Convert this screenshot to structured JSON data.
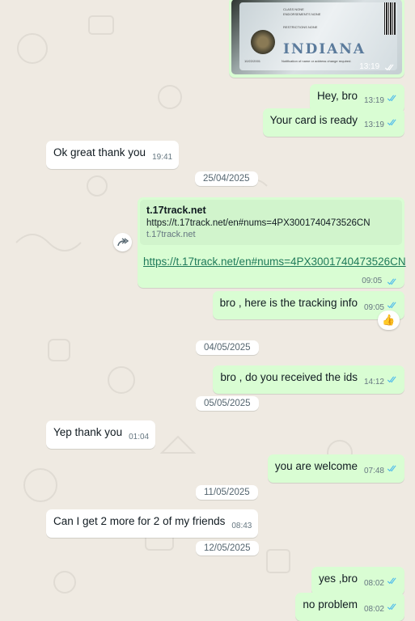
{
  "chat": {
    "id_card": {
      "state": "INDIANA",
      "time": "13:19",
      "fine_print": {
        "class": "CLASS NONE",
        "endorsements": "ENDORSEMENTS NONE",
        "restrictions": "RESTRICTIONS NONE",
        "notice": "Notification of name or address change required.",
        "date": "10/22/2001"
      }
    },
    "messages": [
      {
        "text": "Hey, bro",
        "time": "13:19"
      },
      {
        "text": "Your card is ready",
        "time": "13:19"
      },
      {
        "text": "Ok great thank you",
        "time": "19:41"
      },
      {
        "text": "bro , here is the tracking info",
        "time": "09:05"
      },
      {
        "text": "bro , do you received the ids",
        "time": "14:12"
      },
      {
        "text": "Yep thank you",
        "time": "01:04"
      },
      {
        "text": "you are welcome",
        "time": "07:48"
      },
      {
        "text": "Can I get 2 more for 2 of my friends",
        "time": "08:43"
      },
      {
        "text": "yes ,bro",
        "time": "08:02"
      },
      {
        "text": "no problem",
        "time": "08:02"
      }
    ],
    "dates": [
      "25/04/2025",
      "04/05/2025",
      "05/05/2025",
      "11/05/2025",
      "12/05/2025"
    ],
    "link_message": {
      "preview_title": "t.17track.net",
      "preview_url": "https://t.17track.net/en#nums=4PX3001740473526CN",
      "preview_domain": "t.17track.net",
      "link": "https://t.17track.net/en#nums=4PX3001740473526CN",
      "time": "09:05"
    },
    "reaction": "thumbs-up",
    "colors": {
      "outgoing": "#d9fdd3",
      "incoming": "#ffffff",
      "background": "#efeae2",
      "read_ticks": "#53bdeb"
    }
  }
}
